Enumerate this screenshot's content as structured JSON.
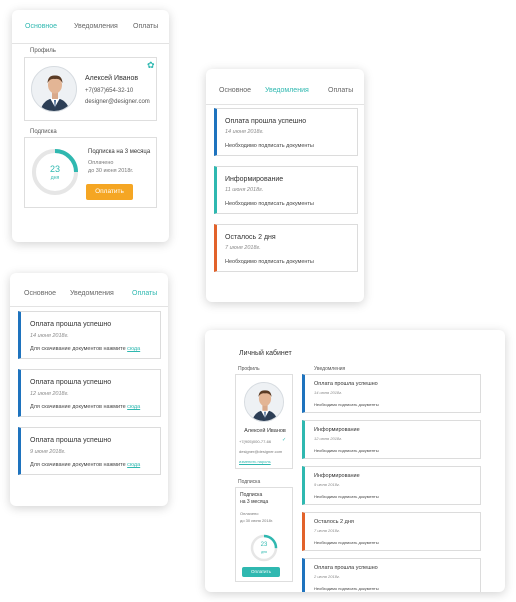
{
  "colors": {
    "blue": "#1e73be",
    "teal": "#2fb8b0",
    "orange": "#e2622a",
    "button_orange": "#f5a623"
  },
  "tabs": {
    "main": "Основное",
    "notifications": "Уведомления",
    "payments": "Оплаты"
  },
  "profile": {
    "section_label": "Профиль",
    "name": "Алексей Иванов",
    "phone": "+7(987)654-32-10",
    "email": "designer@designer.com",
    "phone_desktop": "+7(905)000-77-66",
    "edit_link": "изменить пароль"
  },
  "subscription": {
    "section_label": "Подписка",
    "plan": "Подписка на 3 месяца",
    "plan_line1": "Подписка",
    "plan_line2": "на 3 месяца",
    "paid_label": "Оплачено",
    "paid_until": "до 30 июня 2018г.",
    "days_left": "23",
    "days_unit": "дня",
    "days_fraction": 0.25,
    "pay_button": "Оплатить"
  },
  "notifications": [
    {
      "title": "Оплата прошла успешно",
      "date": "14 июня 2018г.",
      "message": "Необходимо подписать документы",
      "color": "#1e73be"
    },
    {
      "title": "Информирование",
      "date": "11 июня 2018г.",
      "message": "Необходимо подписать документы",
      "color": "#2fb8b0"
    },
    {
      "title": "Осталось 2 дня",
      "date": "7 июня 2018г.",
      "message": "Необходимо подписать документы",
      "color": "#e2622a"
    }
  ],
  "payments": {
    "message_prefix": "Для скачивание документов нажмите",
    "link_text": "сюда",
    "items": [
      {
        "title": "Оплата прошла успешно",
        "date": "14 июня 2018г."
      },
      {
        "title": "Оплата прошла успешно",
        "date": "12 июня 2018г."
      },
      {
        "title": "Оплата прошла успешно",
        "date": "9 июня 2018г."
      }
    ]
  },
  "desktop": {
    "title": "Личный кабинет",
    "profile_label": "Профиль",
    "notifications_label": "Уведомления",
    "subscription_label": "Подписка",
    "notifications": [
      {
        "title": "Оплата прошла успешно",
        "date": "14 июня 2018г.",
        "message": "Необходимо подписать документы",
        "color": "#1e73be"
      },
      {
        "title": "Информирование",
        "date": "12 июня 2018г.",
        "message": "Необходимо подписать документы",
        "color": "#2fb8b0"
      },
      {
        "title": "Информирование",
        "date": "9 июня 2018г.",
        "message": "Необходимо подписать документы",
        "color": "#2fb8b0"
      },
      {
        "title": "Осталось 2 дня",
        "date": "7 июня 2018г.",
        "message": "Необходимо подписать документы",
        "color": "#e2622a"
      },
      {
        "title": "Оплата прошла успешно",
        "date": "2 июня 2018г.",
        "message": "Необходимо подписать документы",
        "color": "#1e73be"
      }
    ]
  }
}
